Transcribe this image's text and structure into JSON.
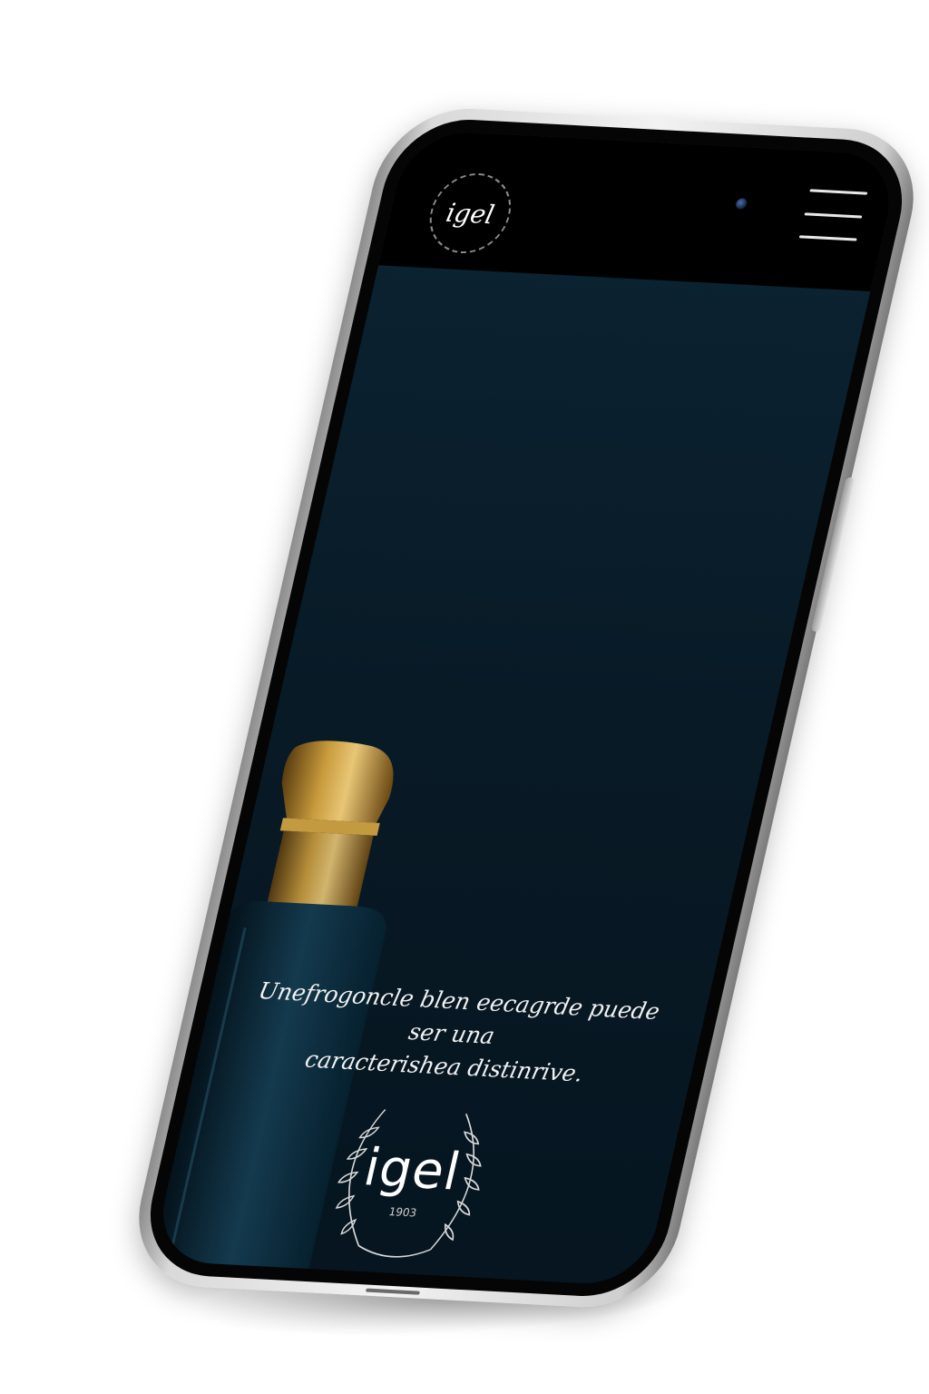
{
  "header": {
    "logo_text": "igel",
    "menu_icon": "hamburger-menu-icon"
  },
  "hero": {
    "tagline_line1": "Unefrogoncle blen eecagrde puede ser una",
    "tagline_line2": "caracterishea distinrive.",
    "emblem_text": "igel",
    "emblem_subtext": "1903",
    "bottle_image": "perfume-bottle-image"
  },
  "colors": {
    "screen_background": "#0a1f2c",
    "header_background": "#000000",
    "text": "#f1f1f1",
    "bottle_cap": "#b8892a",
    "phone_frame": "#d9d9d9"
  }
}
